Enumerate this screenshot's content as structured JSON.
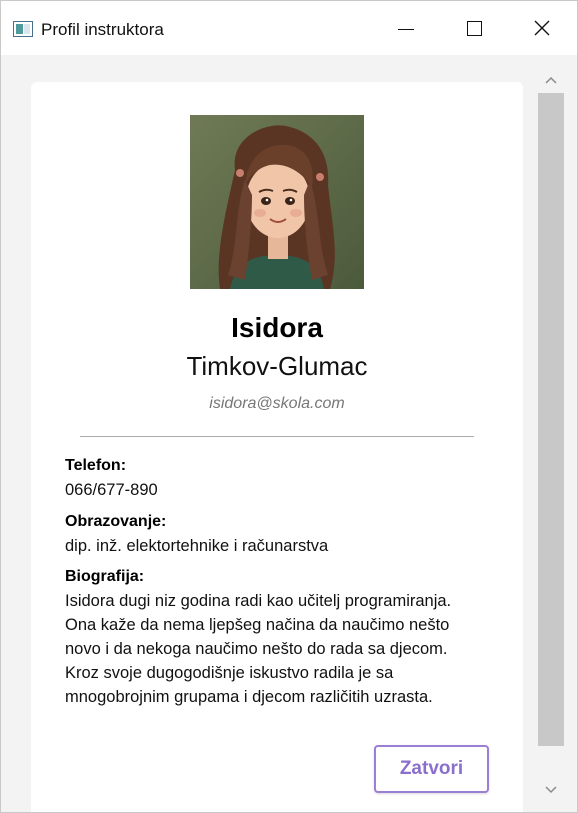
{
  "window": {
    "title": "Profil instruktora",
    "icon": "app-window-icon",
    "controls": {
      "minimize": "minimize-icon",
      "maximize": "maximize-icon",
      "close": "close-icon"
    }
  },
  "profile": {
    "avatar": "instructor-portrait",
    "first_name": "Isidora",
    "last_name": "Timkov-Glumac",
    "email": "isidora@skola.com",
    "phone_label": "Telefon:",
    "phone": "066/677-890",
    "education_label": "Obrazovanje:",
    "education": "dip. inž. elektortehnike i računarstva",
    "bio_label": "Biografija:",
    "bio_lines": [
      "Isidora dugi niz godina radi kao učitelj programiranja.",
      "Ona kaže da nema ljepšeg načina da naučimo nešto",
      "novo i da nekoga naučimo nešto do rada sa djecom.",
      "Kroz svoje dugogodišnje iskustvo radila je sa",
      "mnogobrojnim grupama i djecom različitih uzrasta."
    ]
  },
  "actions": {
    "close_label": "Zatvori"
  },
  "colors": {
    "accent": "#8a6fcc",
    "accent_border": "#9b7fd4",
    "email_text": "#777777",
    "scrollbar_thumb": "#c8c8c8"
  }
}
